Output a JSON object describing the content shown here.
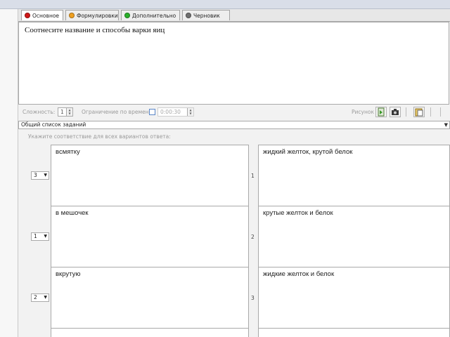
{
  "tabs": [
    {
      "label": "Основное",
      "color": "#d01818",
      "active": true
    },
    {
      "label": "Формулировки",
      "color": "#f0a020",
      "active": false
    },
    {
      "label": "Дополнительно",
      "color": "#2ab02a",
      "active": false
    },
    {
      "label": "Черновик",
      "color": "#707070",
      "active": false
    }
  ],
  "question": {
    "text": "Соотнесите название и способы варки яиц"
  },
  "options": {
    "difficulty_label": "Сложность:",
    "difficulty_value": "1",
    "time_limit_label": "Ограничение по времени:",
    "time_value": "0:00:30",
    "picture_label": "Рисунок"
  },
  "task_list": {
    "selected": "Общий список заданий"
  },
  "instruction": "Укажите соответствие для всех вариантов ответа:",
  "pairs": [
    {
      "select": "3",
      "left": "всмятку",
      "number": "1",
      "right": "жидкий желток, крутой белок"
    },
    {
      "select": "1",
      "left": "в мешочек",
      "number": "2",
      "right": "крутые желток и белок"
    },
    {
      "select": "2",
      "left": "вкрутую",
      "number": "3",
      "right": "жидкие желток и белок"
    }
  ]
}
